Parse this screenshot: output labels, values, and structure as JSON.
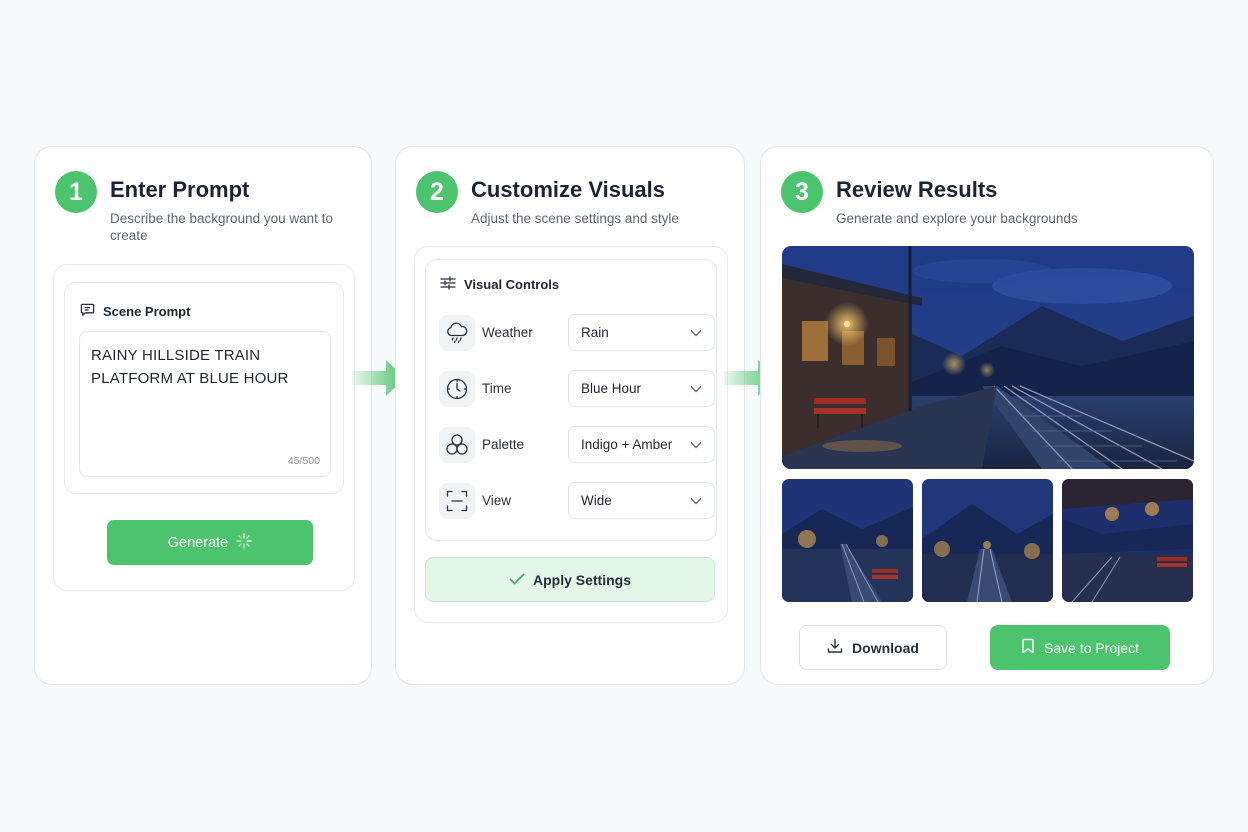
{
  "steps": [
    {
      "number": "1",
      "title": "Enter Prompt",
      "subtitle": "Describe the background you want to create",
      "prompt_label": "Scene Prompt",
      "prompt_value": "RAINY HILLSIDE TRAIN PLATFORM AT BLUE HOUR",
      "char_count": "45/500",
      "generate_label": "Generate"
    },
    {
      "number": "2",
      "title": "Customize Visuals",
      "subtitle": "Adjust the scene settings and style",
      "controls_label": "Visual Controls",
      "controls": [
        {
          "label": "Weather",
          "value": "Rain",
          "icon": "cloud-rain-icon"
        },
        {
          "label": "Time",
          "value": "Blue Hour",
          "icon": "clock-icon"
        },
        {
          "label": "Palette",
          "value": "Indigo + Amber",
          "icon": "palette-circles-icon"
        },
        {
          "label": "View",
          "value": "Wide",
          "icon": "frame-icon"
        }
      ],
      "apply_label": "Apply Settings"
    },
    {
      "number": "3",
      "title": "Review Results",
      "subtitle": "Generate and explore your backgrounds",
      "download_label": "Download",
      "save_label": "Save to Project"
    }
  ],
  "colors": {
    "accent": "#4cc46d",
    "accent_light": "#e3f6e8",
    "night_blue": "#1d2f66",
    "lamp_amber": "#f5b24a"
  }
}
